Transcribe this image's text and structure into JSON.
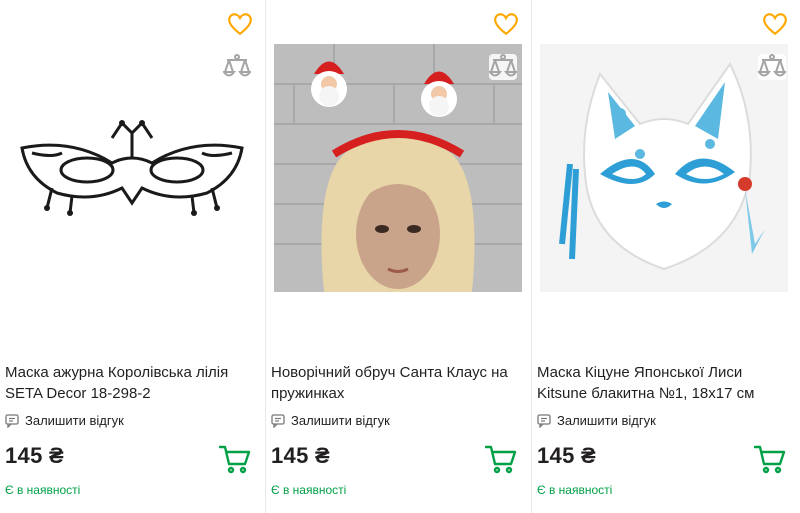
{
  "products": [
    {
      "title": "Маска ажурна Королівська лілія SETA Decor 18-298-2",
      "review_label": "Залишити відгук",
      "price": "145 ₴",
      "availability": "Є в наявності"
    },
    {
      "title": "Новорічний обруч Санта Клаус на пружинках",
      "review_label": "Залишити відгук",
      "price": "145 ₴",
      "availability": "Є в наявності"
    },
    {
      "title": "Маска Кіцуне Японської Лиси Kitsune блакитна №1, 18x17 см",
      "review_label": "Залишити відгук",
      "price": "145 ₴",
      "availability": "Є в наявності"
    }
  ],
  "colors": {
    "accent_green": "#00a046",
    "favorite_yellow": "#ffa900",
    "icon_gray": "#a6a5a5",
    "text": "#221f1f"
  },
  "icons": {
    "favorite": "heart-icon",
    "compare": "scales-icon",
    "review": "comment-icon",
    "cart": "cart-icon"
  }
}
